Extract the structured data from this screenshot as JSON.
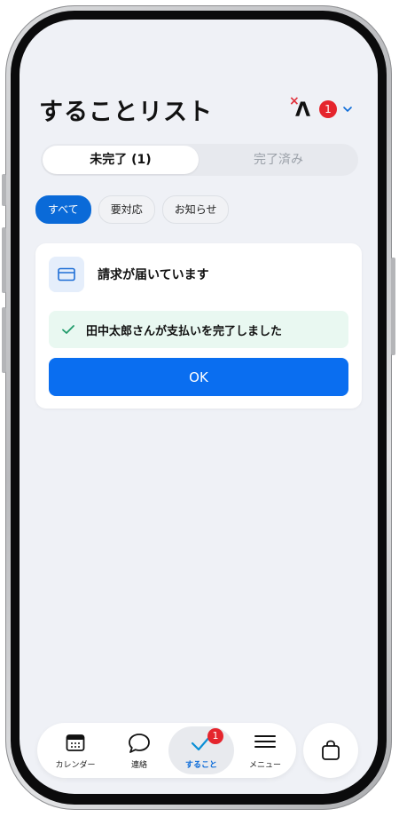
{
  "header": {
    "title": "することリスト",
    "notification_count": "1"
  },
  "tabs": [
    {
      "label": "未完了 (1)",
      "active": true
    },
    {
      "label": "完了済み",
      "active": false
    }
  ],
  "filters": [
    {
      "label": "すべて",
      "selected": true
    },
    {
      "label": "要対応",
      "selected": false
    },
    {
      "label": "お知らせ",
      "selected": false
    }
  ],
  "card": {
    "icon": "credit-card-icon",
    "title": "請求が届いています",
    "status_text": "田中太郎さんが支払いを完了しました",
    "button_label": "OK"
  },
  "bottom_nav": {
    "items": [
      {
        "label": "カレンダー",
        "icon": "calendar-icon"
      },
      {
        "label": "連絡",
        "icon": "chat-bubble-icon"
      },
      {
        "label": "すること",
        "icon": "checkmark-icon",
        "badge": "1",
        "active": true
      },
      {
        "label": "メニュー",
        "icon": "menu-icon"
      }
    ]
  },
  "colors": {
    "accent": "#0a6ef0",
    "badge": "#e5252d",
    "background": "#eff1f6",
    "success_bg": "#e9f8f1"
  }
}
